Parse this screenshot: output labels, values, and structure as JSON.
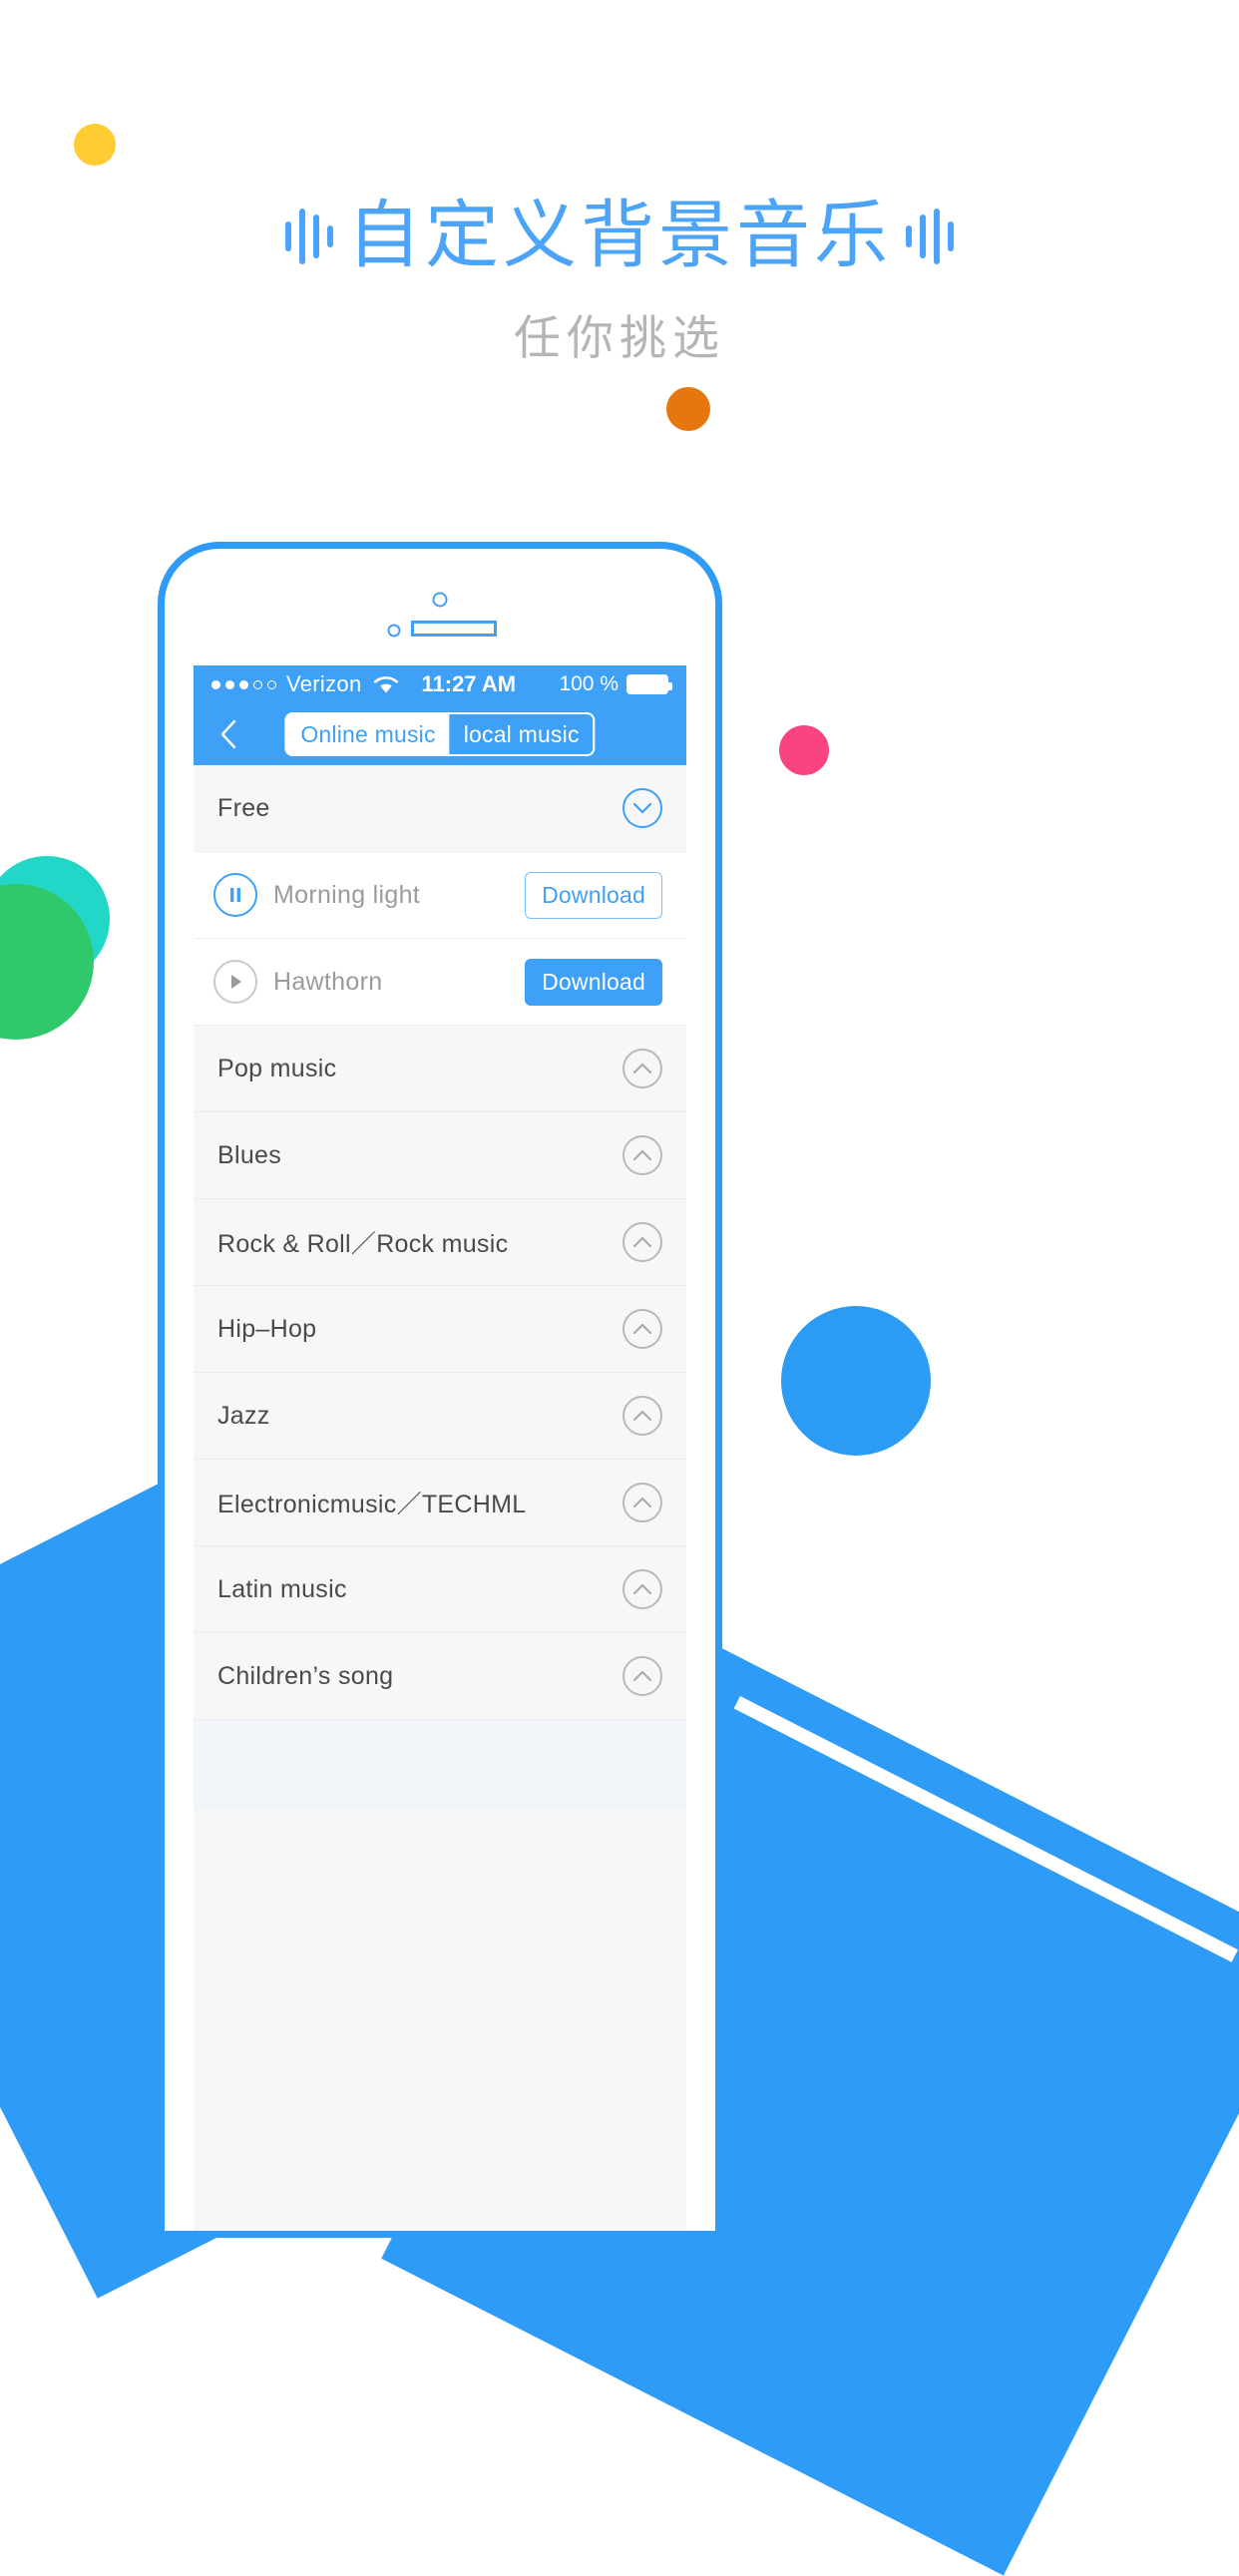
{
  "page": {
    "headline": "自定义背景音乐",
    "subheadline": "任你挑选",
    "headline_color": "#4BA4F7",
    "subheadline_color": "#B5B5B5",
    "accent_color": "#3FA0F7"
  },
  "decorations": [
    {
      "name": "yellow-dot",
      "color": "#FFCC33"
    },
    {
      "name": "orange-dot",
      "color": "#E8760E"
    },
    {
      "name": "pink-dot",
      "color": "#F9447F"
    },
    {
      "name": "teal-dot",
      "color": "#23D7C8"
    },
    {
      "name": "green-dot",
      "color": "#2FC96B"
    },
    {
      "name": "blue-dot",
      "color": "#2C9BF4"
    }
  ],
  "status_bar": {
    "signal_dots_filled": 3,
    "signal_dots_total": 5,
    "carrier": "Verizon",
    "wifi_icon": "wifi-icon",
    "time": "11:27 AM",
    "battery_percent": "100 %",
    "battery_icon": "battery-full-icon"
  },
  "nav_bar": {
    "back_icon": "chevron-left-icon",
    "tabs": [
      {
        "label": "Online music",
        "active": false
      },
      {
        "label": "local music",
        "active": true
      }
    ]
  },
  "list": {
    "section_header": {
      "label": "Free",
      "chevron": "chevron-down-icon",
      "expanded": true
    },
    "songs": [
      {
        "title": "Morning light",
        "state_icon": "pause-icon",
        "button_label": "Download",
        "button_style": "outline"
      },
      {
        "title": "Hawthorn",
        "state_icon": "play-icon",
        "button_label": "Download",
        "button_style": "solid"
      }
    ],
    "categories": [
      {
        "label": "Pop music",
        "chevron": "chevron-up-icon"
      },
      {
        "label": "Blues",
        "chevron": "chevron-up-icon"
      },
      {
        "label": "Rock & Roll／Rock music",
        "chevron": "chevron-up-icon"
      },
      {
        "label": "Hip–Hop",
        "chevron": "chevron-up-icon"
      },
      {
        "label": "Jazz",
        "chevron": "chevron-up-icon"
      },
      {
        "label": "Electronicmusic／TECHML",
        "chevron": "chevron-up-icon"
      },
      {
        "label": "Latin music",
        "chevron": "chevron-up-icon"
      },
      {
        "label": "Children’s song",
        "chevron": "chevron-up-icon"
      }
    ]
  }
}
